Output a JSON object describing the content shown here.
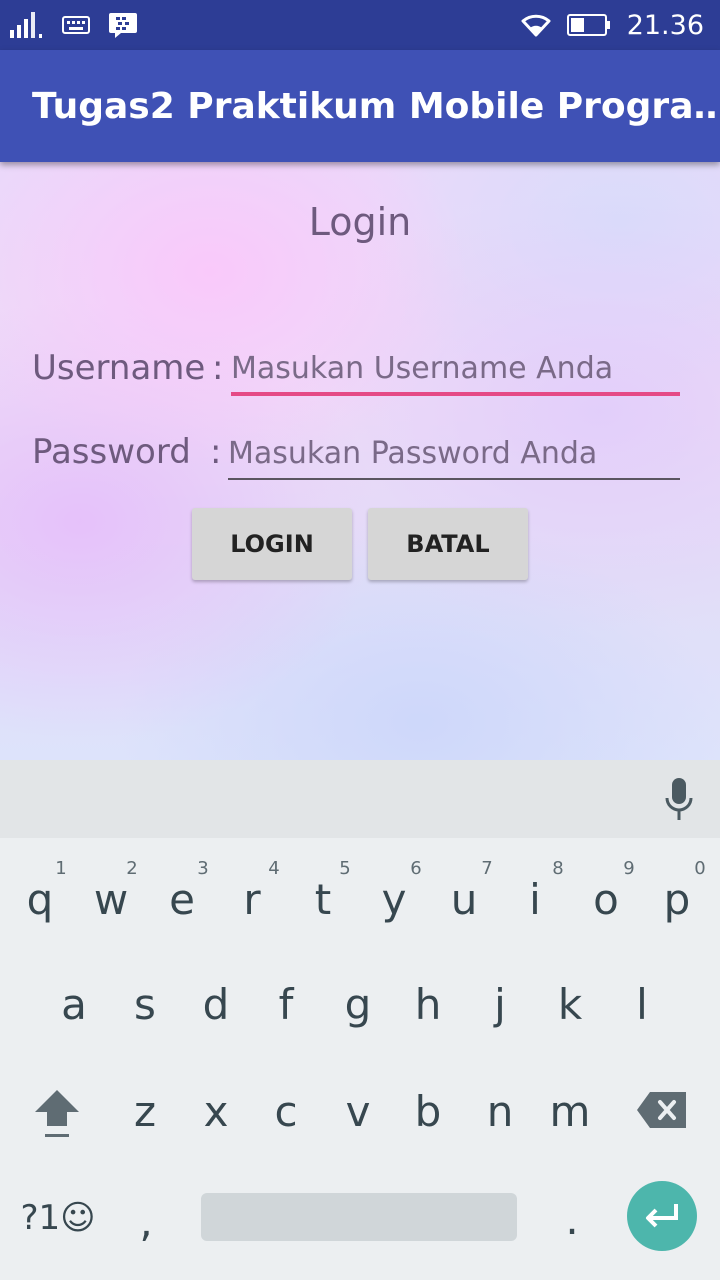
{
  "status_bar": {
    "time": "21.36",
    "icons": [
      "signal-icon",
      "keyboard-status-icon",
      "bbm-icon",
      "wifi-icon",
      "battery-icon"
    ]
  },
  "app_bar": {
    "title": "Tugas2 Praktikum Mobile Progra…",
    "color": "#3f51b5"
  },
  "form": {
    "heading": "Login",
    "username_label": "Username",
    "username_colon": ":",
    "username_placeholder": "Masukan Username Anda",
    "username_value": "",
    "password_label": "Password",
    "password_colon": ":",
    "password_placeholder": "Masukan Password Anda",
    "password_value": "",
    "login_button": "LOGIN",
    "cancel_button": "BATAL",
    "accent_color": "#e54a86"
  },
  "keyboard": {
    "row1": [
      {
        "key": "q",
        "hint": "1"
      },
      {
        "key": "w",
        "hint": "2"
      },
      {
        "key": "e",
        "hint": "3"
      },
      {
        "key": "r",
        "hint": "4"
      },
      {
        "key": "t",
        "hint": "5"
      },
      {
        "key": "y",
        "hint": "6"
      },
      {
        "key": "u",
        "hint": "7"
      },
      {
        "key": "i",
        "hint": "8"
      },
      {
        "key": "o",
        "hint": "9"
      },
      {
        "key": "p",
        "hint": "0"
      }
    ],
    "row2": [
      "a",
      "s",
      "d",
      "f",
      "g",
      "h",
      "j",
      "k",
      "l"
    ],
    "row3": [
      "z",
      "x",
      "c",
      "v",
      "b",
      "n",
      "m"
    ],
    "symbols_key": "?1☺",
    "comma_key": ",",
    "period_key": ".",
    "enter_color": "#4db6ac"
  }
}
